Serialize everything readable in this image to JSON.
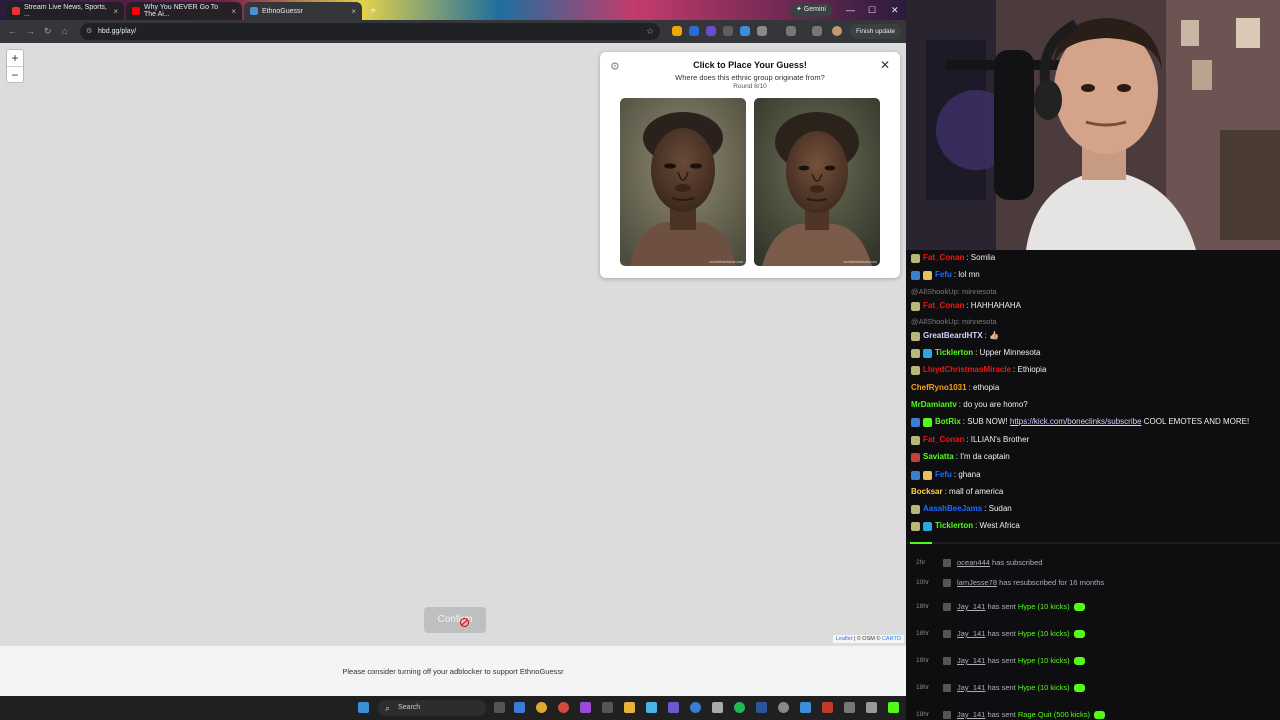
{
  "browser": {
    "tabs": [
      {
        "label": "Stream Live News, Sports, ...",
        "fav_color": "#e33"
      },
      {
        "label": "Why You NEVER Go To The Ai...",
        "fav_color": "#f00"
      },
      {
        "label": "EthnoGuessr",
        "fav_color": "#4a90d9"
      }
    ],
    "gemini_label": "✦ Gemini",
    "url": "hbd.gg/play/",
    "finish_update": "Finish update"
  },
  "map": {
    "zoom_in": "+",
    "zoom_out": "−",
    "attribution_leaflet": "Leaflet",
    "attribution_rest": " | © OSM © ",
    "attribution_carto": "CARTO",
    "confirm_label": "Confirm"
  },
  "panel": {
    "title": "Click to Place Your Guess!",
    "subtitle": "Where does this ethnic group originate from?",
    "round": "Round 8/10",
    "watermark": "worldethnicfaces.com"
  },
  "adblock_message": "Please consider turning off your adblocker to support EthnoGuessr",
  "taskbar": {
    "search": "Search"
  },
  "chat": [
    {
      "user": "Fat_Conan",
      "color": "#e91916",
      "text": ": Somlia",
      "badges": [
        "#b7b779"
      ]
    },
    {
      "user": "Fefu",
      "color": "#1f69ff",
      "text": ": lol mn",
      "badges": [
        "#3a7fd0",
        "#e4c15a"
      ]
    },
    {
      "reply": "@AllShookUp: minnesota"
    },
    {
      "user": "Fat_Conan",
      "color": "#e91916",
      "text": ": HAHHAHAHA",
      "badges": [
        "#b7b779"
      ]
    },
    {
      "reply": "@AllShookUp: minnesota"
    },
    {
      "user": "GreatBeardHTX",
      "color": "#cfd4ff",
      "text": ": 👍🏼",
      "badges": [
        "#b7b779"
      ]
    },
    {
      "user": "Ticklerton",
      "color": "#53fc18",
      "text": ": Upper Minnesota",
      "badges": [
        "#b7b779",
        "#29a8e0"
      ]
    },
    {
      "user": "LloydChristmasMiracle",
      "color": "#e91916",
      "text": ": Ethiopia",
      "badges": [
        "#b7b779"
      ]
    },
    {
      "user": "ChefRyno1031",
      "color": "#ff9f1a",
      "text": ": ethopia",
      "badges": []
    },
    {
      "user": "MrDamiantv",
      "color": "#53fc18",
      "text": ": do you are homo?",
      "badges": []
    },
    {
      "user": "BotRix",
      "color": "#53fc18",
      "text": ": SUB NOW! ",
      "link": "https://kick.com/boneclinks/subscribe",
      "after": " COOL EMOTES AND MORE!",
      "badges": [
        "#3a7fd0",
        "#53fc18"
      ]
    },
    {
      "user": "Fat_Conan",
      "color": "#e91916",
      "text": ": ILLIAN's Brother",
      "badges": [
        "#b7b779"
      ]
    },
    {
      "user": "Saviatta",
      "color": "#53fc18",
      "text": ": I'm da captain",
      "badges": [
        "#c2423c"
      ]
    },
    {
      "user": "Fefu",
      "color": "#1f69ff",
      "text": ": ghana",
      "badges": [
        "#3a7fd0",
        "#e4c15a"
      ]
    },
    {
      "user": "Bocksar",
      "color": "#ffd24a",
      "text": ": mall of america",
      "badges": []
    },
    {
      "user": "AasahBeeJams",
      "color": "#1f69ff",
      "text": ": Sudan",
      "badges": [
        "#b7b779"
      ]
    },
    {
      "user": "Ticklerton",
      "color": "#53fc18",
      "text": ": West Africa",
      "badges": [
        "#b7b779",
        "#29a8e0"
      ]
    }
  ],
  "events": [
    {
      "time": "2hr",
      "user": "ocean444",
      "text": " has subscribed"
    },
    {
      "time": "10hr",
      "user": "lamJesse78",
      "text": " has resubscribed for 16 months"
    },
    {
      "time": "18hr",
      "user": "Jay_141",
      "text": " has sent ",
      "hype": "Hype (10 kicks)"
    },
    {
      "time": "18hr",
      "user": "Jay_141",
      "text": " has sent ",
      "hype": "Hype (10 kicks)"
    },
    {
      "time": "18hr",
      "user": "Jay_141",
      "text": " has sent ",
      "hype": "Hype (10 kicks)"
    },
    {
      "time": "18hr",
      "user": "Jay_141",
      "text": " has sent ",
      "hype": "Hype (10 kicks)"
    },
    {
      "time": "18hr",
      "user": "Jay_141",
      "text": " has sent ",
      "hype": "Rage Quit (500 kicks)"
    }
  ],
  "colors": {
    "kick_green": "#53fc18",
    "chat_bg": "#0e0e10",
    "map_bg": "#dcdcdc"
  }
}
